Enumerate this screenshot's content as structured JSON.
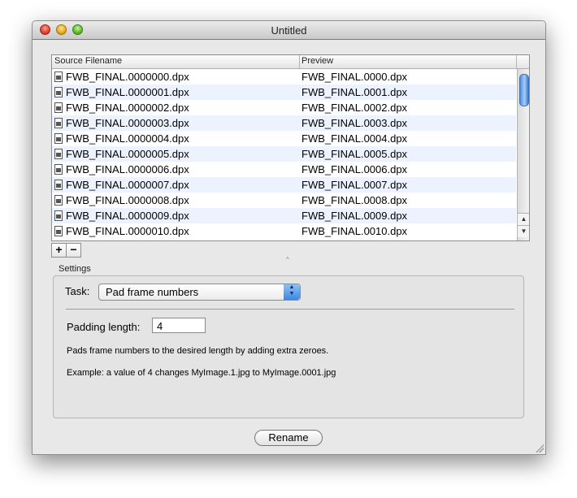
{
  "window": {
    "title": "Untitled"
  },
  "table": {
    "columns": [
      "Source Filename",
      "Preview"
    ],
    "rows": [
      [
        "FWB_FINAL.0000000.dpx",
        "FWB_FINAL.0000.dpx"
      ],
      [
        "FWB_FINAL.0000001.dpx",
        "FWB_FINAL.0001.dpx"
      ],
      [
        "FWB_FINAL.0000002.dpx",
        "FWB_FINAL.0002.dpx"
      ],
      [
        "FWB_FINAL.0000003.dpx",
        "FWB_FINAL.0003.dpx"
      ],
      [
        "FWB_FINAL.0000004.dpx",
        "FWB_FINAL.0004.dpx"
      ],
      [
        "FWB_FINAL.0000005.dpx",
        "FWB_FINAL.0005.dpx"
      ],
      [
        "FWB_FINAL.0000006.dpx",
        "FWB_FINAL.0006.dpx"
      ],
      [
        "FWB_FINAL.0000007.dpx",
        "FWB_FINAL.0007.dpx"
      ],
      [
        "FWB_FINAL.0000008.dpx",
        "FWB_FINAL.0008.dpx"
      ],
      [
        "FWB_FINAL.0000009.dpx",
        "FWB_FINAL.0009.dpx"
      ],
      [
        "FWB_FINAL.0000010.dpx",
        "FWB_FINAL.0010.dpx"
      ]
    ]
  },
  "buttons": {
    "add": "+",
    "remove": "−",
    "rename": "Rename"
  },
  "settings": {
    "section_label": "Settings",
    "task_label": "Task:",
    "task_value": "Pad frame numbers",
    "padding_label": "Padding length:",
    "padding_value": "4",
    "description": "Pads frame numbers to the desired length by adding extra zeroes.",
    "example": "Example: a value of 4 changes MyImage.1.jpg to MyImage.0001.jpg"
  },
  "icons": {
    "file": "document-icon",
    "scroll_up": "arrow-up-icon",
    "scroll_down": "arrow-down-icon",
    "select": "popup-arrows-icon",
    "resize": "resize-grip-icon"
  }
}
